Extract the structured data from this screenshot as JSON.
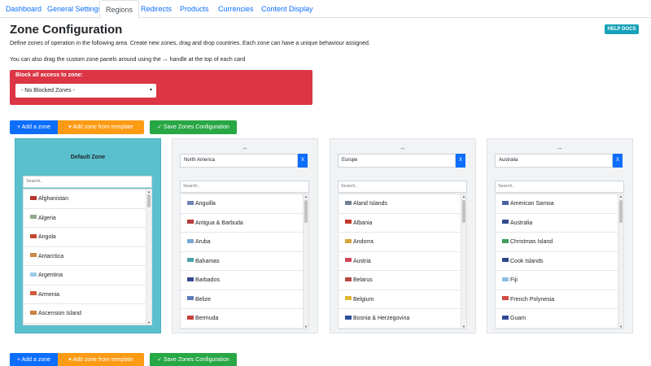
{
  "tabs": [
    {
      "label": "Dashboard",
      "active": false
    },
    {
      "label": "General Settings",
      "active": false
    },
    {
      "label": "Regions",
      "active": true
    },
    {
      "label": "Redirects",
      "active": false
    },
    {
      "label": "Products",
      "active": false
    },
    {
      "label": "Currencies",
      "active": false
    },
    {
      "label": "Content Display",
      "active": false
    }
  ],
  "page": {
    "title": "Zone Configuration",
    "help_label": "HELP DOCS",
    "desc1": "Define zones of operation in the following area. Create new zones, drag and drop countries. Each zone can have a unique behaviour assigned.",
    "desc2": "You can also drag the custom zone panels around using the ↔ handle at the top of each card"
  },
  "block": {
    "label": "Block all access to zone:",
    "selected": "- No Blocked Zones -"
  },
  "buttons": {
    "add_zone": "+ Add a zone",
    "add_template": "▾ Add zone from template",
    "save": "✓ Save Zones Configuration"
  },
  "accent_colors": {
    "primary": "#0d6efd",
    "danger": "#dc3545",
    "warning": "#fd9b15",
    "success": "#28a745",
    "info": "#17a2b8",
    "default_zone": "#5bc0cd"
  },
  "zones": [
    {
      "name": "Default Zone",
      "is_default": true,
      "search_placeholder": "Search..",
      "countries": [
        "Afghanistan",
        "Algeria",
        "Angola",
        "Antarctica",
        "Argentina",
        "Armenia",
        "Ascension Island"
      ]
    },
    {
      "name": "North America",
      "is_default": false,
      "close_label": "X",
      "drag_handle": "↔",
      "search_placeholder": "Search..",
      "countries": [
        "Anguilla",
        "Antigua & Barbuda",
        "Aruba",
        "Bahamas",
        "Barbados",
        "Belize",
        "Bermuda"
      ]
    },
    {
      "name": "Europe",
      "is_default": false,
      "close_label": "X",
      "drag_handle": "↔",
      "search_placeholder": "Search..",
      "countries": [
        "Aland Islands",
        "Albania",
        "Andorra",
        "Austria",
        "Belarus",
        "Belgium",
        "Bosnia & Herzegovina"
      ]
    },
    {
      "name": "Australia",
      "is_default": false,
      "close_label": "X",
      "drag_handle": "↔",
      "search_placeholder": "Search..",
      "countries": [
        "American Samoa",
        "Australia",
        "Christmas Island",
        "Cook Islands",
        "Fiji",
        "French Polynesia",
        "Guam"
      ]
    }
  ]
}
